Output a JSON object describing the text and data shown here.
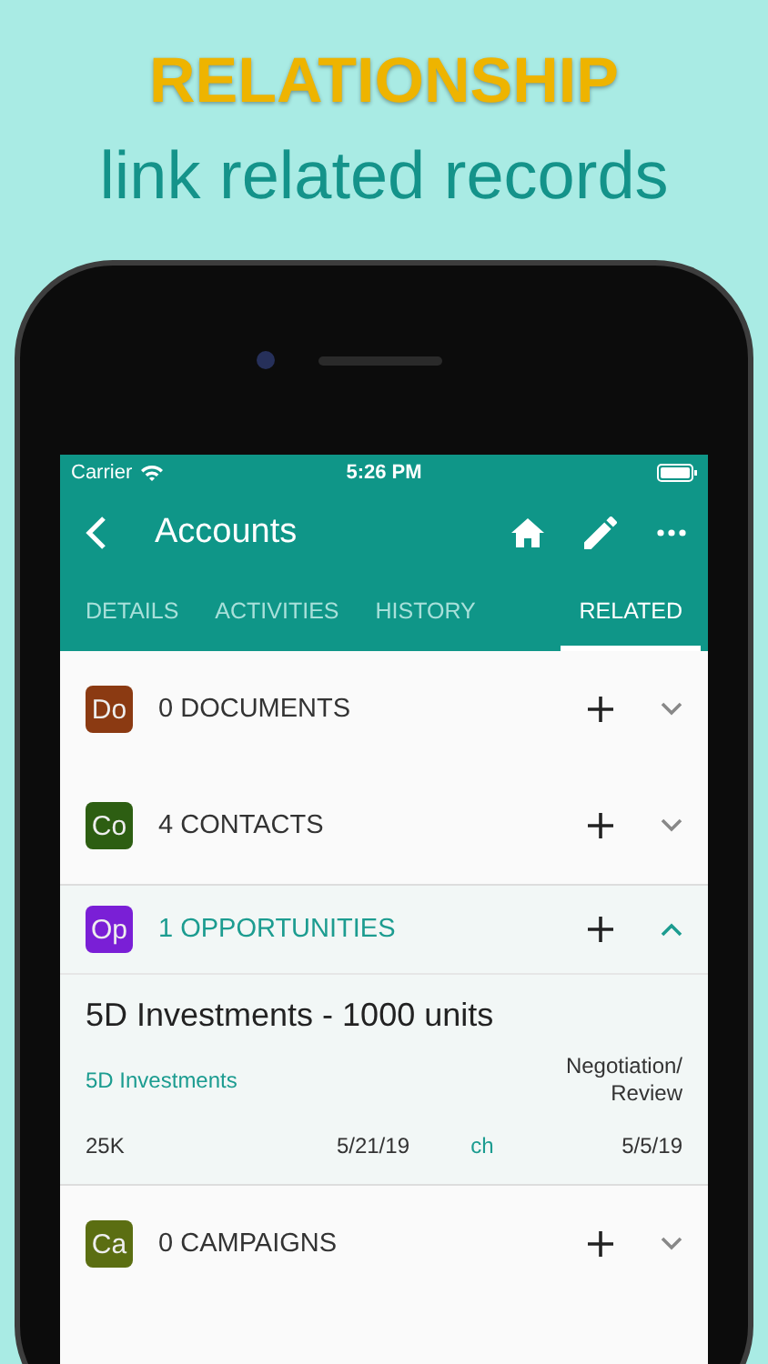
{
  "headline": {
    "title": "RELATIONSHIP",
    "subtitle": "link related records"
  },
  "status_bar": {
    "carrier": "Carrier",
    "time": "5:26 PM"
  },
  "app_bar": {
    "title": "Accounts"
  },
  "tabs": [
    {
      "label": "DETAILS",
      "selected": false
    },
    {
      "label": "ACTIVITIES",
      "selected": false
    },
    {
      "label": "HISTORY",
      "selected": false
    },
    {
      "label": "RELATED",
      "selected": true
    }
  ],
  "sections": [
    {
      "abbr": "Do",
      "color": "#8b3a12",
      "label": "0 DOCUMENTS",
      "expanded": false
    },
    {
      "abbr": "Co",
      "color": "#2d5e12",
      "label": "4 CONTACTS",
      "expanded": false
    },
    {
      "abbr": "Op",
      "color": "#7a1fd6",
      "label": "1 OPPORTUNITIES",
      "expanded": true,
      "records": [
        {
          "name": "5D Investments - 1000 units",
          "account": "5D Investments",
          "stage": "Negotiation/ Review",
          "amount": "25K",
          "date_1": "5/21/19",
          "owner": "ch",
          "date_2": "5/5/19"
        }
      ]
    },
    {
      "abbr": "Ca",
      "color": "#5b6e12",
      "label": "0 CAMPAIGNS",
      "expanded": false
    }
  ]
}
